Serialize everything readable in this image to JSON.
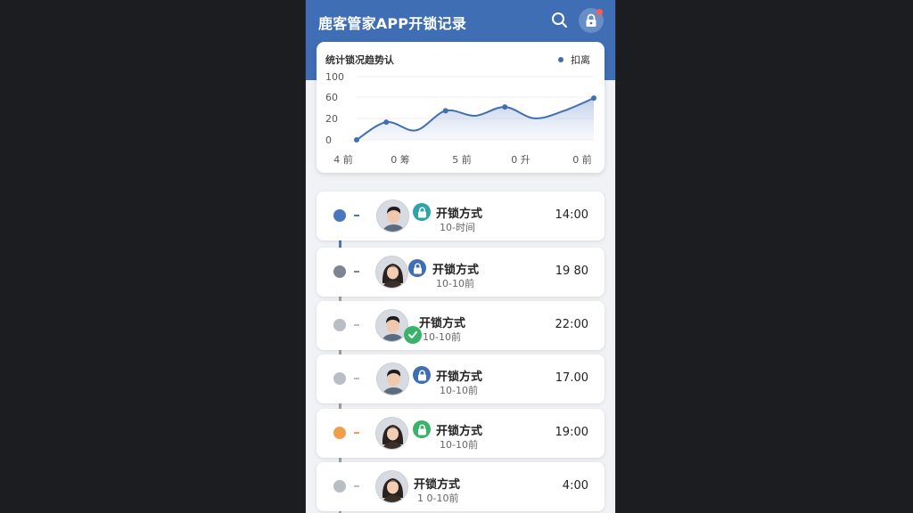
{
  "app": {
    "title": "鹿客管家APP开锁记录",
    "search_icon": "search-icon",
    "lock_icon": "lock-icon"
  },
  "colors": {
    "header": "#3f6eb5",
    "accent": "#3f6eb5",
    "teal": "#2ea3a8",
    "green": "#3ab36a",
    "orange": "#f0a04a",
    "notification": "#ff5a4e"
  },
  "chart_card": {
    "title": "统计锁况趋势认",
    "legend": "扣离"
  },
  "chart_data": {
    "type": "area",
    "title": "统计锁况趋势认",
    "x_tick_labels": [
      "4 前",
      "0 筹",
      "5 前",
      "0 升",
      "0 前"
    ],
    "y_tick_labels": [
      "100",
      "60",
      "20",
      "0"
    ],
    "ylim": [
      0,
      100
    ],
    "x": [
      0,
      1,
      2,
      3,
      4,
      5,
      6,
      7,
      8
    ],
    "values": [
      0,
      28,
      15,
      46,
      38,
      52,
      34,
      46,
      66
    ],
    "series": [
      {
        "name": "扣离",
        "values": [
          0,
          28,
          15,
          46,
          38,
          52,
          34,
          46,
          66
        ]
      }
    ],
    "grid": true,
    "legend_position": "top-right"
  },
  "records": [
    {
      "title": "开锁方式",
      "sub": "10-时间",
      "time": "14:00",
      "node_color": "#4a76bd",
      "badge_color": "#2ea3a8",
      "badge_icon": "lock-icon",
      "avatar": "male-avatar"
    },
    {
      "title": "开锁方式",
      "sub": "10-10前",
      "time": "19 80",
      "node_color": "#7d8592",
      "badge_color": "#3f6eb5",
      "badge_icon": "lock-icon",
      "avatar": "female-avatar"
    },
    {
      "title": "开锁方式",
      "sub": "10-10前",
      "time": "22:00",
      "node_color": "#b9bdc4",
      "badge_color": "#3ab36a",
      "badge_icon": "check-icon",
      "avatar": "male-avatar"
    },
    {
      "title": "开锁方式",
      "sub": "10-10前",
      "time": "17.00",
      "node_color": "#b9bdc4",
      "badge_color": "#3f6eb5",
      "badge_icon": "lock-icon",
      "avatar": "male-avatar"
    },
    {
      "title": "开锁方式",
      "sub": "10-10前",
      "time": "19:00",
      "node_color": "#f0a04a",
      "badge_color": "#3ab36a",
      "badge_icon": "lock-icon",
      "avatar": "female-avatar"
    },
    {
      "title": "开锁方式",
      "sub": "1 0-10前",
      "time": "4:00",
      "node_color": "#b9bdc4",
      "badge_color": "",
      "badge_icon": "",
      "avatar": "female-avatar"
    }
  ]
}
